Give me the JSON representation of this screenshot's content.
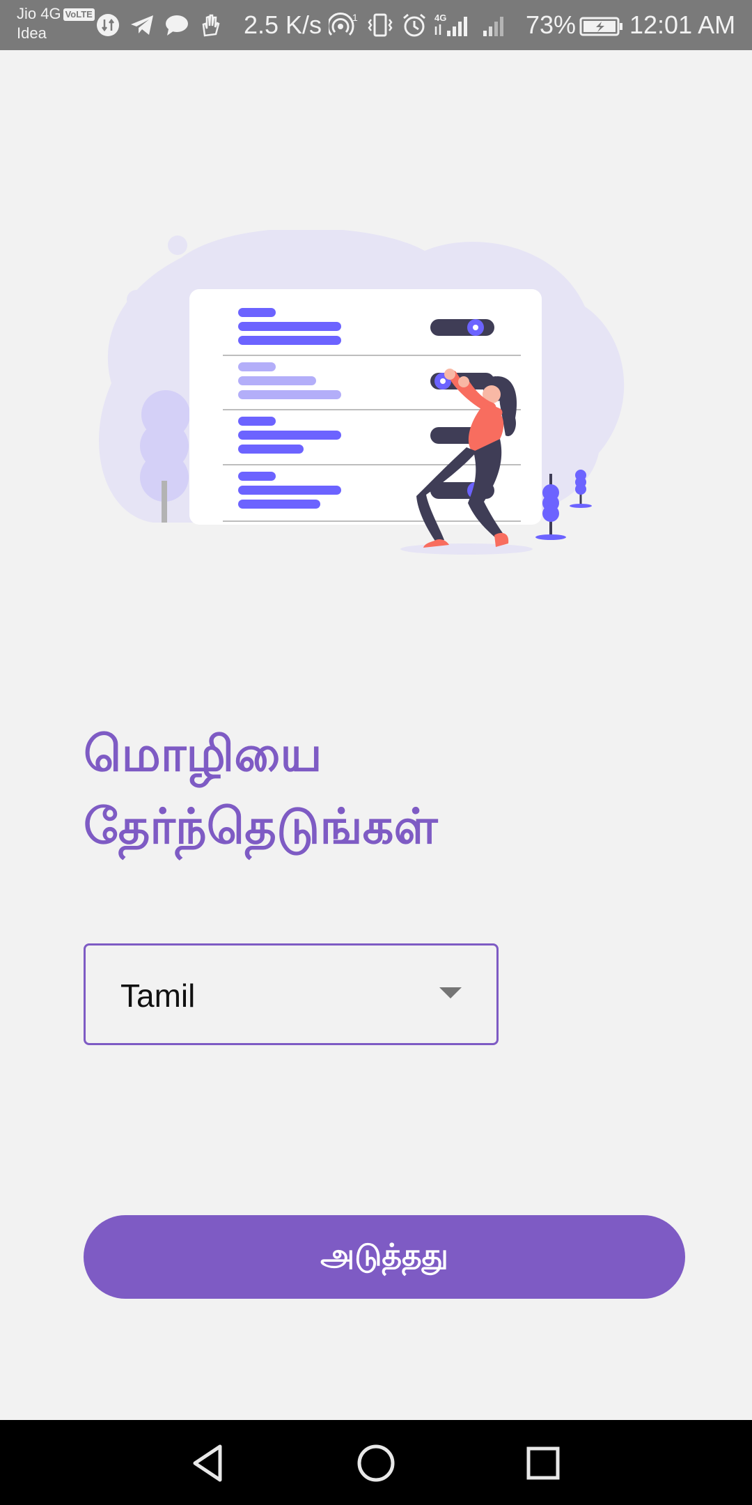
{
  "status_bar": {
    "carrier_line1": "Jio 4G",
    "carrier_volte": "VoLTE",
    "carrier_line2": "Idea",
    "net_speed": "2.5 K/s",
    "battery_percent": "73%",
    "time": "12:01 AM",
    "icons": [
      "data-transfer-icon",
      "telegram-icon",
      "chat-icon",
      "hand-icon",
      "hotspot-icon",
      "vibrate-icon",
      "alarm-icon",
      "signal-4g-icon",
      "signal-icon",
      "battery-charging-icon"
    ]
  },
  "illustration": {
    "name": "person-adjusting-toggles-illustration",
    "colors": {
      "accent": "#6c63ff",
      "blob": "#e6e4f5",
      "dark": "#3f3d56",
      "shirt": "#f86d5f"
    }
  },
  "title": "மொழியை தேர்ந்தெடுங்கள்",
  "language_dropdown": {
    "selected": "Tamil"
  },
  "next_button": {
    "label": "அடுத்தது"
  },
  "nav_bar": {
    "icons": [
      "back-icon",
      "home-icon",
      "recents-icon"
    ]
  },
  "colors": {
    "primary": "#7e5bc4",
    "background": "#f2f2f2",
    "status_bar": "#7a7a7a"
  }
}
